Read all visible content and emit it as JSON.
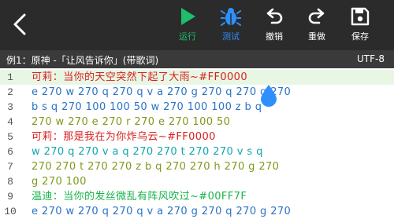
{
  "toolbar": {
    "run_label": "运行",
    "test_label": "测试",
    "undo_label": "撤销",
    "redo_label": "重做",
    "save_label": "保存",
    "colors": {
      "run": "#1dbf6a",
      "test": "#2f8fff",
      "bg": "#2b2b2b"
    }
  },
  "subheader": {
    "title": "例1：原神 -「让风告诉你」(带歌词)",
    "encoding": "UTF-8"
  },
  "editor": {
    "lines": [
      {
        "num": "1",
        "text": "可莉：当你的天空突然下起了大雨~#FF0000"
      },
      {
        "num": "2",
        "text": "e 270 w 270 q 270 q v a 270 g 270 q 270 g 270"
      },
      {
        "num": "3",
        "text": "b s q 270 100 100 50 w 270 100 100 z b q"
      },
      {
        "num": "4",
        "text": "270 w 270 e 270 r 270 e 270 100 50"
      },
      {
        "num": "5",
        "text": "可莉：那是我在为你炸乌云~#FF0000"
      },
      {
        "num": "6",
        "text": "w 270 q 270 v a q 270 270 t 270 270 v s q"
      },
      {
        "num": "7",
        "text": "270 270 t 270 270 z b q 270 270 h 270 g 270"
      },
      {
        "num": "8",
        "text": "g 270 100"
      },
      {
        "num": "9",
        "text": "温迪：当你的发丝微乱有阵风吹过~#00FF7F"
      },
      {
        "num": "10",
        "text": "e 270 w 270 q 270 q v a 270 g 270 q 270 g 270"
      }
    ]
  }
}
